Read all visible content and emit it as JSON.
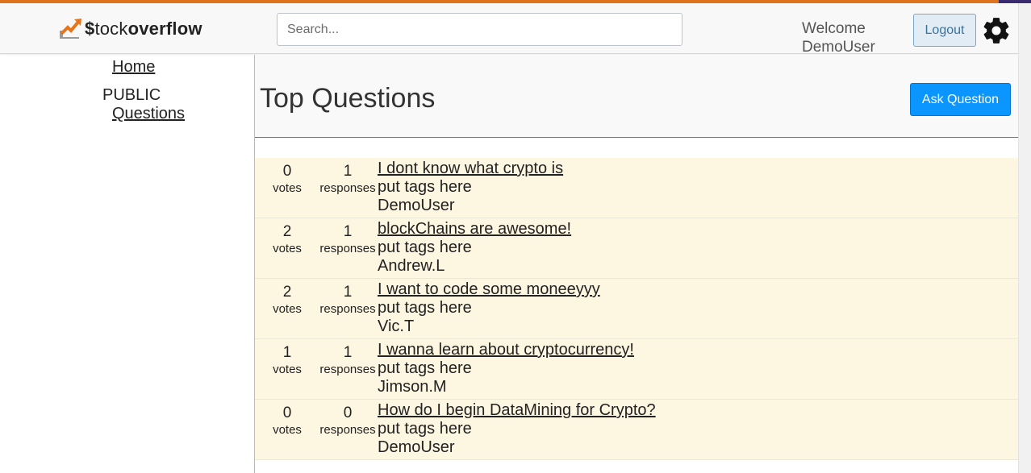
{
  "brand": {
    "prefix": "$",
    "tock": "tock",
    "overflow": "overflow"
  },
  "search": {
    "placeholder": "Search..."
  },
  "user": {
    "welcome_line1": "Welcome",
    "welcome_line2": "DemoUser",
    "logout_label": "Logout"
  },
  "sidebar": {
    "home": "Home",
    "section": "PUBLIC",
    "questions": "Questions"
  },
  "main": {
    "title": "Top Questions",
    "ask_label": "Ask Question"
  },
  "questions": [
    {
      "votes": "0",
      "votes_label": "votes",
      "responses": "1",
      "responses_label": "responses",
      "title": "I dont know what crypto is",
      "tags": "put tags here",
      "author": "DemoUser"
    },
    {
      "votes": "2",
      "votes_label": "votes",
      "responses": "1",
      "responses_label": "responses",
      "title": "blockChains are awesome!",
      "tags": "put tags here",
      "author": "Andrew.L"
    },
    {
      "votes": "2",
      "votes_label": "votes",
      "responses": "1",
      "responses_label": "responses",
      "title": "I want to code some moneeyyy",
      "tags": "put tags here",
      "author": "Vic.T"
    },
    {
      "votes": "1",
      "votes_label": "votes",
      "responses": "1",
      "responses_label": "responses",
      "title": "I wanna learn about cryptocurrency!",
      "tags": "put tags here",
      "author": "Jimson.M"
    },
    {
      "votes": "0",
      "votes_label": "votes",
      "responses": "0",
      "responses_label": "responses",
      "title": "How do I begin DataMining for Crypto?",
      "tags": "put tags here",
      "author": "DemoUser"
    }
  ],
  "colors": {
    "accent": "#0a95ff",
    "row_bg": "#fdf7e2",
    "logout_bg": "#e1ecf4",
    "brand_orange": "#e0711d"
  },
  "icons": {
    "logo": "stockoverflow-logo",
    "settings": "gear-icon"
  }
}
